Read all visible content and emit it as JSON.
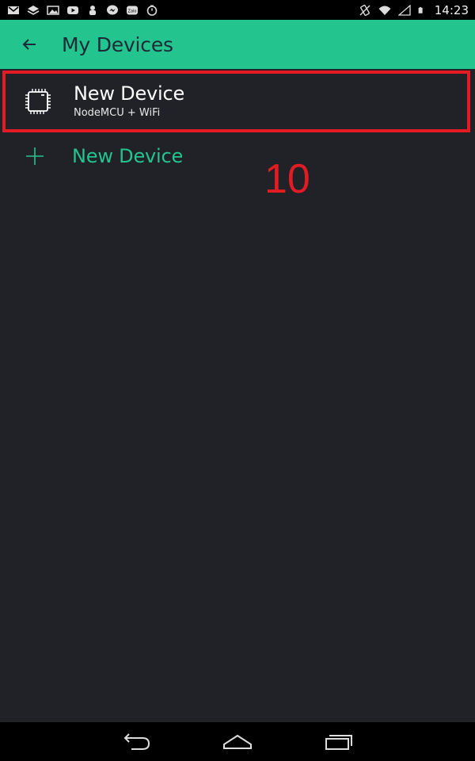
{
  "status_bar": {
    "time": "14:23",
    "left_icons": [
      "mail-icon",
      "stack-icon",
      "image-icon",
      "youtube-icon",
      "cook-icon",
      "messenger-icon",
      "zalo-icon",
      "timer-icon"
    ],
    "right_icons": [
      "vibrate-icon",
      "wifi-icon",
      "signal-icon",
      "battery-icon"
    ]
  },
  "app_bar": {
    "title": "My Devices",
    "background": "#23c48e"
  },
  "devices": [
    {
      "name": "New Device",
      "subtitle": "NodeMCU + WiFi",
      "icon": "chip-icon"
    }
  ],
  "add_device": {
    "label": "New Device",
    "icon": "plus-icon"
  },
  "annotation": {
    "text": "10",
    "color": "#e31c24"
  },
  "nav_bar": {
    "buttons": [
      "back-nav-icon",
      "home-nav-icon",
      "recents-nav-icon"
    ]
  },
  "colors": {
    "accent": "#23c48e",
    "background": "#212227",
    "highlight": "#e31c24"
  }
}
